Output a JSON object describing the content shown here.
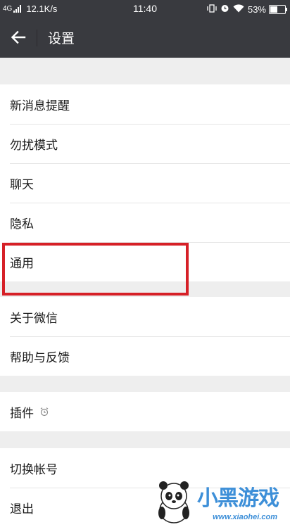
{
  "status_bar": {
    "network": "4G",
    "speed": "12.1K/s",
    "time": "11:40",
    "battery": "53%",
    "battery_level": 0.53
  },
  "app_bar": {
    "title": "设置",
    "back_icon": "arrow-left-icon"
  },
  "groups": [
    {
      "items": [
        {
          "label": "新消息提醒"
        },
        {
          "label": "勿扰模式"
        },
        {
          "label": "聊天"
        },
        {
          "label": "隐私"
        },
        {
          "label": "通用"
        }
      ]
    },
    {
      "items": [
        {
          "label": "关于微信"
        },
        {
          "label": "帮助与反馈"
        }
      ]
    },
    {
      "items": [
        {
          "label": "插件",
          "icon": "alarm-clock-icon"
        }
      ]
    },
    {
      "items": [
        {
          "label": "切换帐号"
        },
        {
          "label": "退出"
        }
      ]
    }
  ],
  "highlight": {
    "target": "通用",
    "color": "#d62027"
  },
  "watermark": {
    "brand": "小黑游戏",
    "url": "www.xiaohei.com"
  },
  "colors": {
    "header": "#393a3f",
    "background": "#eeeeee",
    "divider": "#e5e5e5"
  }
}
